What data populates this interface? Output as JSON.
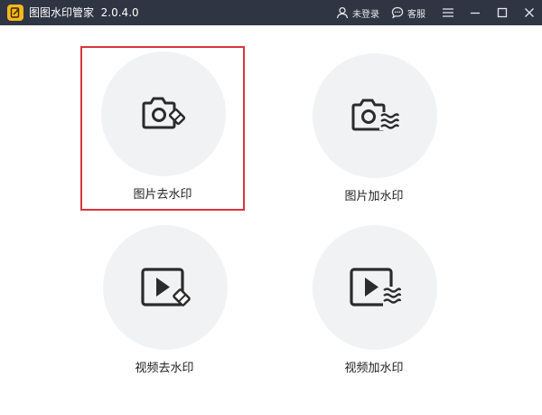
{
  "app": {
    "name": "图图水印管家",
    "version": "2.0.4.0",
    "logo_icon": "app-logo-icon",
    "logo_color": "#f6b81c"
  },
  "titlebar": {
    "background": "#2f3542",
    "login_label": "未登录",
    "login_icon": "user-icon",
    "service_label": "客服",
    "service_icon": "chat-bubble-icon",
    "controls": [
      "menu-icon",
      "minimize-icon",
      "maximize-icon",
      "close-icon"
    ]
  },
  "main": {
    "selected_index": 0,
    "selection_color": "#d9363e",
    "cards": [
      {
        "label": "图片去水印",
        "icon": "camera-eraser-icon"
      },
      {
        "label": "图片加水印",
        "icon": "camera-watermark-icon"
      },
      {
        "label": "视频去水印",
        "icon": "video-eraser-icon"
      },
      {
        "label": "视频加水印",
        "icon": "video-watermark-icon"
      }
    ]
  }
}
